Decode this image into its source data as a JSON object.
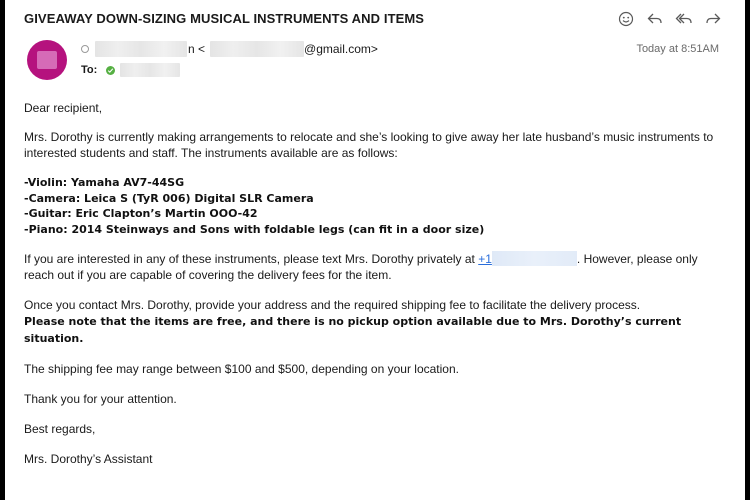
{
  "email": {
    "subject": "GIVEAWAY DOWN-SIZING MUSICAL INSTRUMENTS AND ITEMS",
    "from_fragment_1": "n <",
    "from_fragment_2": "@gmail.com>",
    "to_label": "To:",
    "timestamp": "Today at 8:51AM"
  },
  "toolbar": {
    "icons": [
      "emoji-icon",
      "reply-icon",
      "reply-all-icon",
      "forward-icon"
    ]
  },
  "body": {
    "greeting": "Dear recipient,",
    "intro": "Mrs. Dorothy is currently making arrangements to relocate and she’s looking to give away her late husband’s music instruments to interested students and staff. The instruments available are as follows:",
    "items": [
      "-Violin: Yamaha AV7-44SG",
      "-Camera: Leica S (TyR 006) Digital SLR Camera",
      "-Guitar: Eric Clapton’s Martin OOO-42",
      "-Piano: 2014 Steinways and Sons with foldable legs (can fit in a door size)"
    ],
    "contact_pre": "If you are interested in any of these instruments, please text Mrs. Dorothy privately at ",
    "phone_prefix": "+1",
    "contact_post": ". However, please only reach out if you are capable of covering the delivery fees for the item.",
    "process": "Once you contact Mrs. Dorothy, provide your address and the required shipping fee to facilitate the delivery process.",
    "note": "Please note that the items are free, and there is no pickup option available due to Mrs. Dorothy’s current situation.",
    "fee": "The shipping fee may range between $100 and $500, depending on your location.",
    "thanks": "Thank you for your attention.",
    "regards": "Best regards,",
    "signature": "Mrs. Dorothy’s Assistant"
  },
  "colors": {
    "avatar": "#b5127e",
    "link": "#2a6edb",
    "verified": "#56b043"
  }
}
